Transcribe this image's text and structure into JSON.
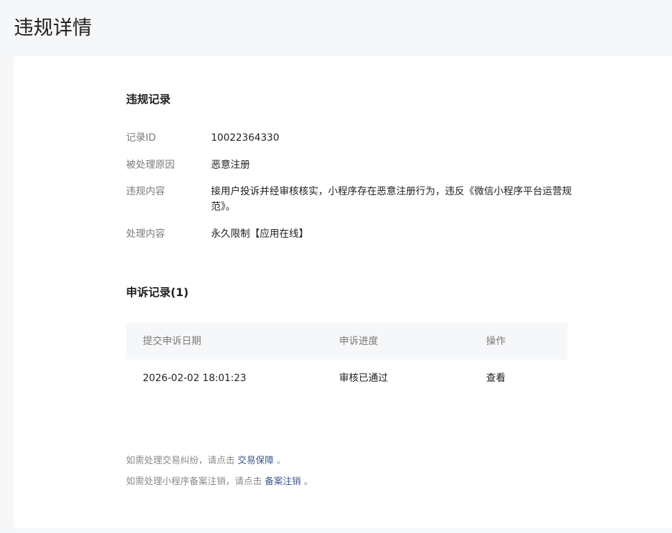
{
  "page": {
    "title": "违规详情"
  },
  "violation": {
    "section_title": "违规记录",
    "rows": [
      {
        "label": "记录ID",
        "value": "10022364330"
      },
      {
        "label": "被处理原因",
        "value": "恶意注册"
      },
      {
        "label": "违规内容",
        "value": "接用户投诉并经审核核实，小程序存在恶意注册行为，违反《微信小程序平台运营规范》。"
      },
      {
        "label": "处理内容",
        "value": "永久限制【应用在线】"
      }
    ]
  },
  "appeal": {
    "section_title": "申诉记录(1)",
    "columns": [
      "提交申诉日期",
      "申诉进度",
      "操作"
    ],
    "rows": [
      {
        "date": "2026-02-02 18:01:23",
        "status": "审核已通过",
        "action": "查看"
      }
    ]
  },
  "footer": {
    "line1_prefix": "如需处理交易纠纷，请点击",
    "line1_link": "交易保障",
    "line1_suffix": "。",
    "line2_prefix": "如需处理小程序备案注销，请点击",
    "line2_link": "备案注销",
    "line2_suffix": "。"
  },
  "colors": {
    "background": "#f6f7f9",
    "card": "#ffffff",
    "link": "#3b5a8f",
    "label": "#7b7b7b",
    "text": "#1f1f1f"
  }
}
